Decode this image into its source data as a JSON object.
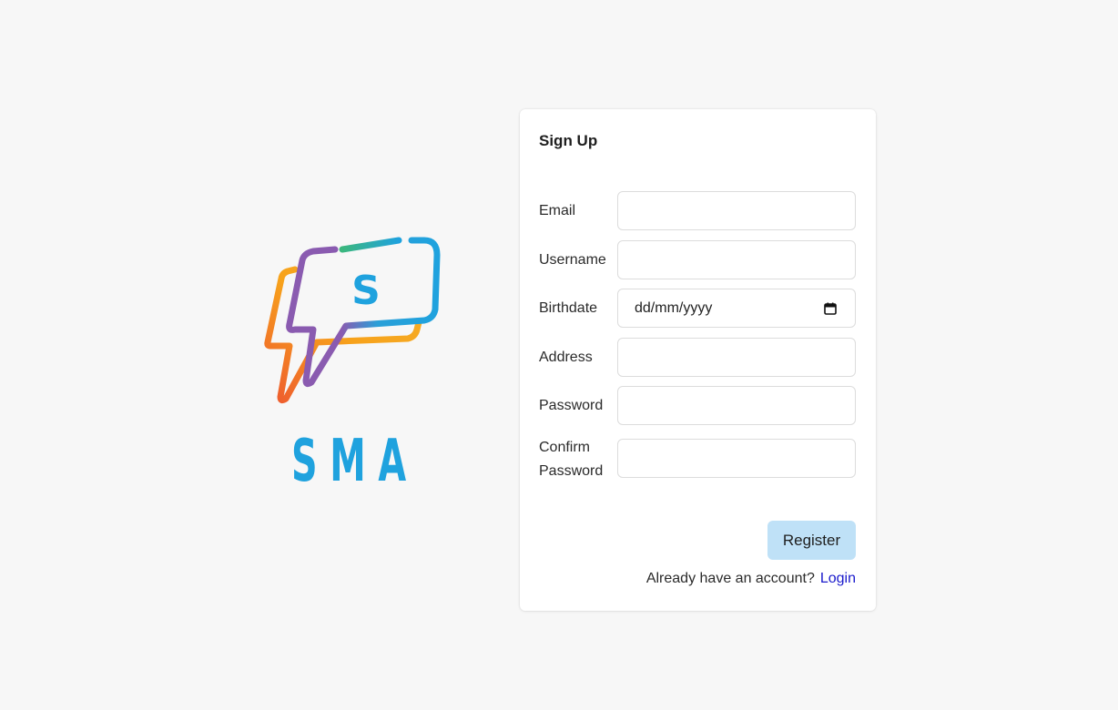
{
  "brand": {
    "name": "SMA",
    "logo_letter": "S",
    "colors": {
      "orange": "#f07a2a",
      "purple": "#8a5bb0",
      "blue": "#1fa2de",
      "green": "#3bb77e"
    }
  },
  "form": {
    "title": "Sign Up",
    "fields": {
      "email": {
        "label": "Email",
        "value": ""
      },
      "username": {
        "label": "Username",
        "value": ""
      },
      "birthdate": {
        "label": "Birthdate",
        "placeholder": "dd/mm/yyyy"
      },
      "address": {
        "label": "Address",
        "value": ""
      },
      "password": {
        "label": "Password",
        "value": ""
      },
      "confirm_password": {
        "label_line1": "Confirm",
        "label_line2": "Password",
        "value": ""
      }
    },
    "register_label": "Register",
    "register_color": "#bfe1f7",
    "footer": {
      "prompt": "Already have an account?",
      "login_label": "Login"
    }
  }
}
